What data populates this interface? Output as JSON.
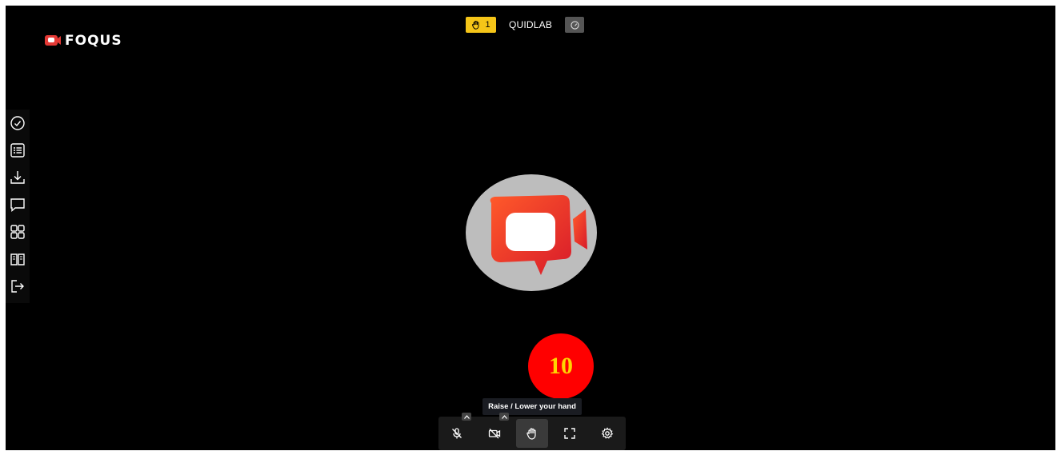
{
  "app": {
    "brand": "FOQUS"
  },
  "topbar": {
    "hand_count": "1",
    "room_name": "QUIDLAB"
  },
  "sidebar": {
    "items": [
      {
        "icon": "check-circle-icon"
      },
      {
        "icon": "list-icon"
      },
      {
        "icon": "download-icon"
      },
      {
        "icon": "chat-icon"
      },
      {
        "icon": "grid-icon"
      },
      {
        "icon": "book-icon"
      },
      {
        "icon": "exit-icon"
      }
    ]
  },
  "overlay": {
    "step_number": "10"
  },
  "tooltip": {
    "text": "Raise / Lower your hand"
  },
  "controls": [
    {
      "icon": "mic-off-icon"
    },
    {
      "icon": "camera-off-icon"
    },
    {
      "icon": "hand-icon"
    },
    {
      "icon": "fullscreen-icon"
    },
    {
      "icon": "settings-icon"
    }
  ],
  "colors": {
    "accent": "#f5c518",
    "brand_red": "#e53935",
    "badge_red": "#ff0000",
    "badge_text": "#ffd400"
  }
}
